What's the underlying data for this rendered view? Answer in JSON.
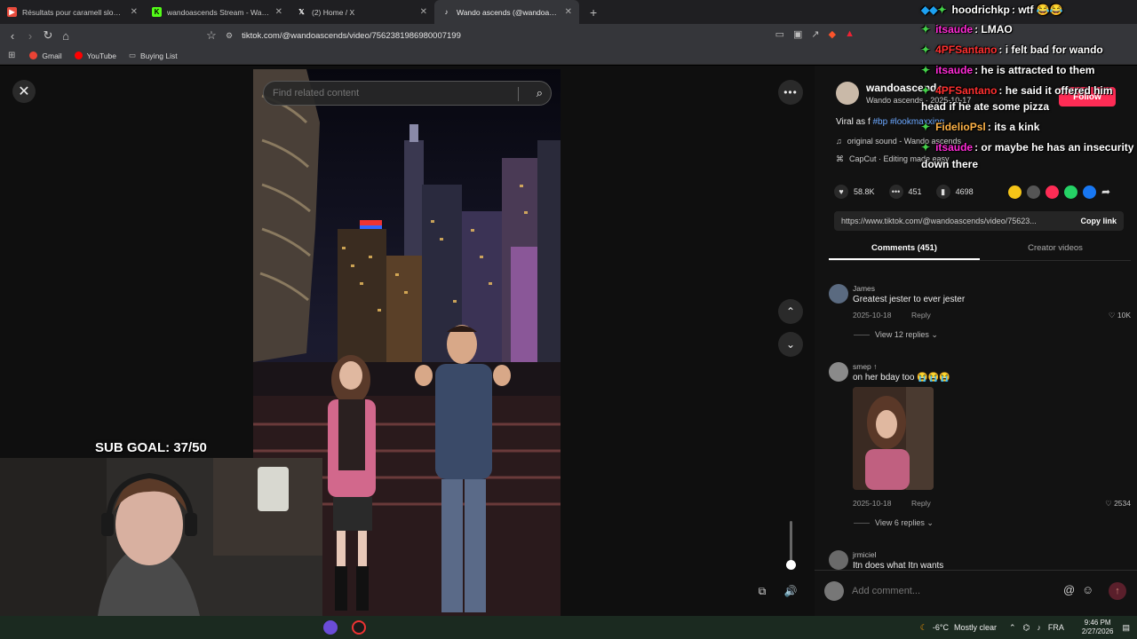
{
  "browser": {
    "tabs": [
      {
        "title": "Résultats pour caramell slowed reverb",
        "favicon_color": "#e84b3c",
        "active": false
      },
      {
        "title": "wandoascends Stream - Watch Live on Kick",
        "favicon_color": "#53fc18",
        "active": false
      },
      {
        "title": "(2) Home / X",
        "favicon_color": "#ffffff",
        "active": false
      },
      {
        "title": "Wando ascends (@wandoascends)",
        "favicon_color": "#ffffff",
        "active": true
      }
    ],
    "url": "tiktok.com/@wandoascends/video/7562381986980007199",
    "bookmarks": [
      {
        "label": "Gmail",
        "color": "#ea4335"
      },
      {
        "label": "YouTube",
        "color": "#ff0000"
      },
      {
        "label": "Buying List",
        "color": "#bbbbbb"
      }
    ]
  },
  "video": {
    "search_placeholder": "Find related content"
  },
  "creator": {
    "name": "wandoascends",
    "subtitle": "Wando ascends · 2025-10-17",
    "follow_label": "Follow",
    "caption_text": "Viral as f ",
    "caption_tags": "#bp #lookmaxxing",
    "sound": "original sound - Wando ascends",
    "capcut": "CapCut · Editing made easy"
  },
  "stats": {
    "likes": "58.8K",
    "comments": "451",
    "saves": "4698"
  },
  "share": {
    "colors": [
      "#f5c518",
      "#555555",
      "#fe2c55",
      "#25d366",
      "#1877f2"
    ]
  },
  "link": {
    "url": "https://www.tiktok.com/@wandoascends/video/75623...",
    "copy_label": "Copy link"
  },
  "panel_tabs": [
    "Comments (451)",
    "Creator videos"
  ],
  "comments": [
    {
      "user": "James",
      "text": "Greatest jester to ever jester",
      "date": "2025-10-18",
      "reply": "Reply",
      "likes": "10K",
      "view_replies": "View 12 replies"
    },
    {
      "user": "smep ↑",
      "text": "on her bday too 😭😭😭",
      "date": "2025-10-18",
      "reply": "Reply",
      "likes": "2534",
      "view_replies": "View 6 replies"
    },
    {
      "user": "jrmiciel",
      "text": "Itn does what Itn wants"
    }
  ],
  "add_comment": {
    "placeholder": "Add comment..."
  },
  "overlay": {
    "sub_goal": "SUB GOAL: 37/50"
  },
  "chat": [
    {
      "user": "hoodrichkp",
      "user_color": "#ffffff",
      "text": ": wtf 😂😂"
    },
    {
      "user": "itsaude",
      "user_color": "#ff2bd6",
      "text": ": LMAO"
    },
    {
      "user": "4PFSantano",
      "user_color": "#ff3030",
      "text": ": i felt bad for wando"
    },
    {
      "user": "itsaude",
      "user_color": "#ff2bd6",
      "text": ": he is attracted to them"
    },
    {
      "user": "4PFSantano",
      "user_color": "#ff3030",
      "text": ": he said it offered him"
    },
    {
      "user": "",
      "user_color": "#ffffff",
      "text": "head if he ate some pizza"
    },
    {
      "user": "FidelioPsl",
      "user_color": "#ffb347",
      "text": ": its a kink"
    },
    {
      "user": "itsaude",
      "user_color": "#ff2bd6",
      "text": ": or maybe he has an insecurity"
    },
    {
      "user": "",
      "user_color": "#ffffff",
      "text": "down there"
    }
  ],
  "taskbar": {
    "temp": "-6°C",
    "weather": "Mostly clear",
    "lang": "FRA",
    "time": "9:46 PM",
    "date": "2/27/2026"
  }
}
